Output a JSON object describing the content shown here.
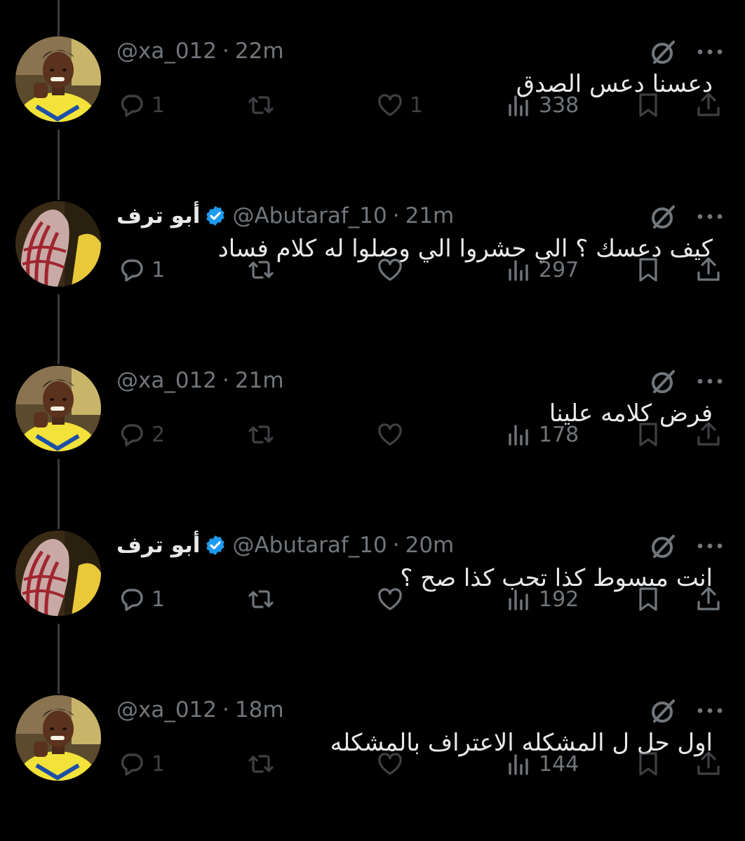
{
  "tweets": [
    {
      "name": "",
      "verified": false,
      "handle": "@xa_012",
      "time": "22m",
      "text": "دعسنا دعس الصدق",
      "replies": "1",
      "retweets": "",
      "likes": "1",
      "views": "338",
      "avatar": "player",
      "dim": true
    },
    {
      "name": "أبو ترف",
      "verified": true,
      "handle": "@Abutaraf_10",
      "time": "21m",
      "text": "كيف دعسك ؟ الي حشروا الي وصلوا له كلام فساد",
      "replies": "1",
      "retweets": "",
      "likes": "",
      "views": "297",
      "avatar": "shemagh",
      "dim": false
    },
    {
      "name": "",
      "verified": false,
      "handle": "@xa_012",
      "time": "21m",
      "text": "فرض كلامه علينا",
      "replies": "2",
      "retweets": "",
      "likes": "",
      "views": "178",
      "avatar": "player",
      "dim": true
    },
    {
      "name": "أبو ترف",
      "verified": true,
      "handle": "@Abutaraf_10",
      "time": "20m",
      "text": "انت مبسوط كذا تحب كذا صح ؟",
      "replies": "1",
      "retweets": "",
      "likes": "",
      "views": "192",
      "avatar": "shemagh",
      "dim": false
    },
    {
      "name": "",
      "verified": false,
      "handle": "@xa_012",
      "time": "18m",
      "text": "اول حل ل المشكله الاعتراف بالمشكله",
      "replies": "1",
      "retweets": "",
      "likes": "",
      "views": "144",
      "avatar": "player",
      "dim": true
    }
  ],
  "colors": {
    "background": "#000000",
    "text": "#e7e9ea",
    "muted": "#71767b",
    "verified": "#1d9bf0",
    "jersey": "#f2e23a"
  },
  "icons": [
    "reply-icon",
    "retweet-icon",
    "like-icon",
    "views-icon",
    "bookmark-icon",
    "share-icon",
    "grok-icon",
    "more-icon",
    "verified-badge-icon"
  ]
}
